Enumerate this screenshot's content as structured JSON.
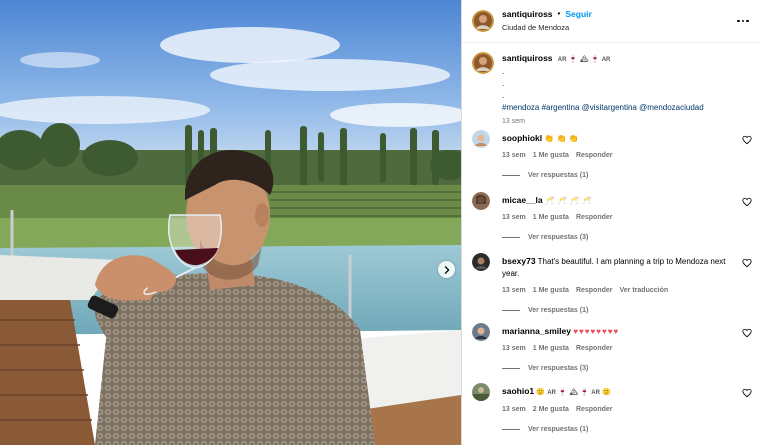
{
  "post": {
    "username": "santiquiross",
    "follow_label": "Seguir",
    "dot": "•",
    "location": "Ciudad de Mendoza",
    "more_icon": "more-icon"
  },
  "caption": {
    "username": "santiquiross",
    "flag1": "AR",
    "flag2": "AR",
    "lines": [
      ".",
      ".",
      "."
    ],
    "hashtags": "#mendoza #argentina @visitargentina @mendozaciudad",
    "time": "13 sem"
  },
  "comments": [
    {
      "username": "soophiokl",
      "text": "👏 👏 👏",
      "time": "13 sem",
      "likes": "1 Me gusta",
      "reply": "Responder",
      "translate": "",
      "replies": "Ver respuestas (1)"
    },
    {
      "username": "micae__la",
      "text": "🥂 🥂 🥂 🥂",
      "time": "13 sem",
      "likes": "1 Me gusta",
      "reply": "Responder",
      "translate": "",
      "replies": "Ver respuestas (3)"
    },
    {
      "username": "bsexy73",
      "text": "That's beautiful. I am planning a trip to Mendoza next year.",
      "time": "13 sem",
      "likes": "1 Me gusta",
      "reply": "Responder",
      "translate": "Ver traducción",
      "replies": "Ver respuestas (1)"
    },
    {
      "username": "marianna_smiley",
      "text": "♥♥♥♥♥♥♥♥",
      "time": "13 sem",
      "likes": "1 Me gusta",
      "reply": "Responder",
      "translate": "",
      "replies": "Ver respuestas (3)"
    },
    {
      "username": "saohio1",
      "flag1": "AR",
      "flag2": "AR",
      "time": "13 sem",
      "likes": "2 Me gusta",
      "reply": "Responder",
      "translate": "",
      "replies": "Ver respuestas (1)"
    }
  ],
  "colors": {
    "follow": "#0095f6",
    "hashtag": "#00376b",
    "muted": "#737373",
    "heart_red": "#ed4956"
  }
}
